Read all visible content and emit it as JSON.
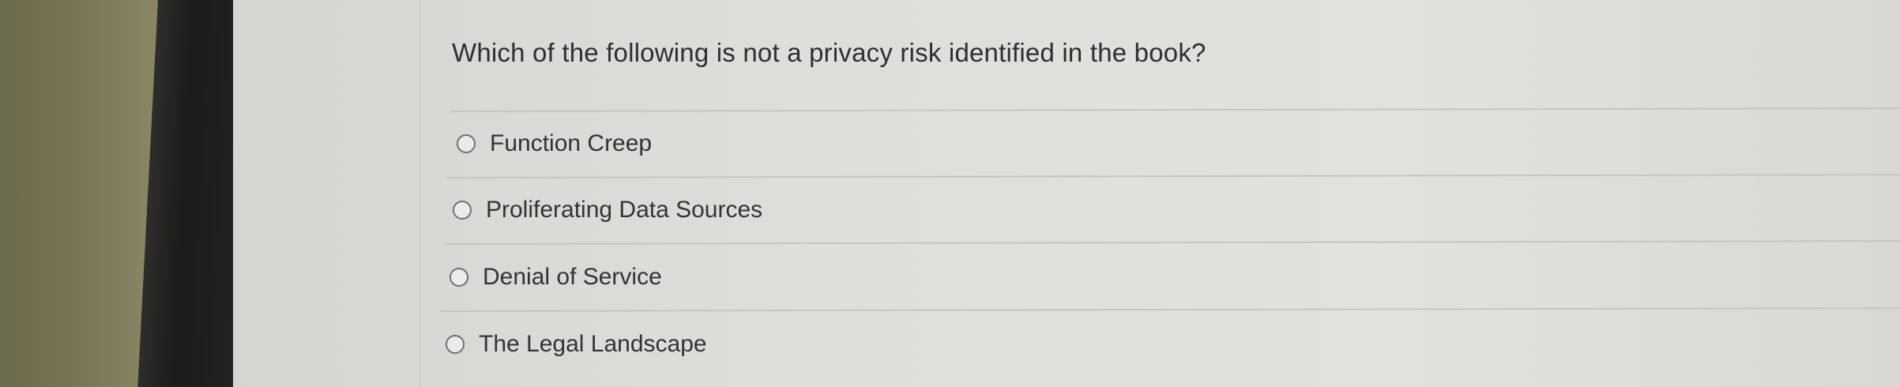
{
  "quiz": {
    "question": "Which of the following is not a privacy risk identified in the book?",
    "options": [
      {
        "label": "Function Creep",
        "selected": false
      },
      {
        "label": "Proliferating Data Sources",
        "selected": false
      },
      {
        "label": "Denial of Service",
        "selected": false
      },
      {
        "label": "The Legal Landscape",
        "selected": false
      }
    ]
  }
}
